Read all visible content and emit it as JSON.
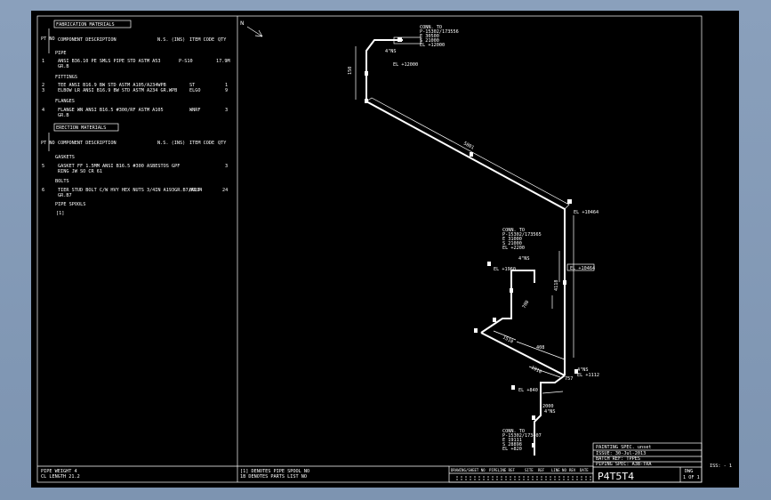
{
  "bom": {
    "fab_header": "FABRICATION MATERIALS",
    "pt_no": "PT NO",
    "col_component": "COMPONENT DESCRIPTION",
    "col_ns": "N.S. (INS)",
    "col_item": "ITEM CODE",
    "col_qty": "QTY",
    "section_pipe": "PIPE",
    "pipe_item": {
      "pt": "1",
      "desc": "ANSI B36.10 PE SMLS PIPE STD ASTM A53",
      "desc2": "GR.B",
      "ns": "8",
      "code": "P-S10",
      "qty": "17.9M"
    },
    "section_fittings": "FITTINGS",
    "fitting_items": [
      {
        "pt": "2",
        "desc": "TEE ANSI B16.9 BW STD ASTM A105/A234WPB",
        "code": "ST",
        "qty": "1"
      },
      {
        "pt": "3",
        "desc": "ELBOW LR ANSI B16.9 BW STD ASTM A234 GR.WPB",
        "code": "ELGO",
        "qty": "9"
      }
    ],
    "section_flanges": "FLANGES",
    "flange_item": {
      "pt": "4",
      "desc": "FLANGE WN ANSI B16.5 #300/RF ASTM A105",
      "desc2": "GR.B",
      "code": "WNRF",
      "qty": "3"
    },
    "erection_header": "ERECTION MATERIALS",
    "section_gaskets": "GASKETS",
    "gasket_item": {
      "pt": "5",
      "desc": "GASKET FF 1.5MM ANSI B16.5 #300 ASBESTOS GPF",
      "desc2": "RING JW SO CR 61",
      "qty": "3"
    },
    "section_bolts": "BOLTS",
    "bolt_item": {
      "pt": "6",
      "desc": "TIER STUD BOLT C/W HVY HEX NUTS 3/4IN A193GR.B7/A194",
      "desc2": "GR.B7",
      "code": "BOLT",
      "qty": "24"
    },
    "section_spools": "PIPE SPOOLS",
    "spool_item": "[1]",
    "footer_left_1": "PIPE WEIGHT  4",
    "footer_left_2": "CL LENGTH  21.2"
  },
  "iso": {
    "north": "N",
    "conn_top": [
      "CONN. TO",
      "P-15302/173556",
      "E 30500",
      "S 21000",
      "EL +12000"
    ],
    "elev_12000": "EL +12000",
    "dim_150": "150",
    "dim_4ns": "4\"NS",
    "dim_5801": "5801",
    "elev_10464": "EL +10464",
    "conn_mid": [
      "CONN. TO",
      "P-15302/173565",
      "E 31000",
      "S 21000",
      "EL +2200"
    ],
    "elev_1960": "EL +1960",
    "dim_2ns": "4\"NS",
    "dim_4118": "4118",
    "dim_700": "700",
    "dim_1510": "1510",
    "dim_408": "408",
    "dim_1910": "1910",
    "dim_757": "757",
    "dim_4ns_b": "4\"NS",
    "elev_1112": "EL +1112",
    "elev_840": "EL +840",
    "dim_1110": "1110",
    "conn_bot": [
      "CONN. TO",
      "P-15302/173407",
      "E 19111",
      "S 28898",
      "EL +820"
    ],
    "small_notes": [
      "2000",
      "1000",
      "4\"NS"
    ]
  },
  "titleblock": {
    "painting": "PAINTING SPEC. unset",
    "design": "ISSUE: 30-Jul-2013",
    "batch": "BATCH REF: TPPES",
    "piping": "PIPING SPEC: A3B-TRA",
    "headers": [
      "DRAWING/SHEET NO",
      "PIPELINE REF",
      "SITE",
      "REF",
      "LINE NO",
      "REV",
      "DATE"
    ],
    "drawing_no": "P4T5T4",
    "dwg_label": "DWG",
    "sheet": "1 OF 1",
    "issue": "ISS: - 1",
    "notes_1": "[1] DENOTES PIPE SPOOL NO",
    "notes_2": "1B DENOTES PARTS LIST NO"
  }
}
